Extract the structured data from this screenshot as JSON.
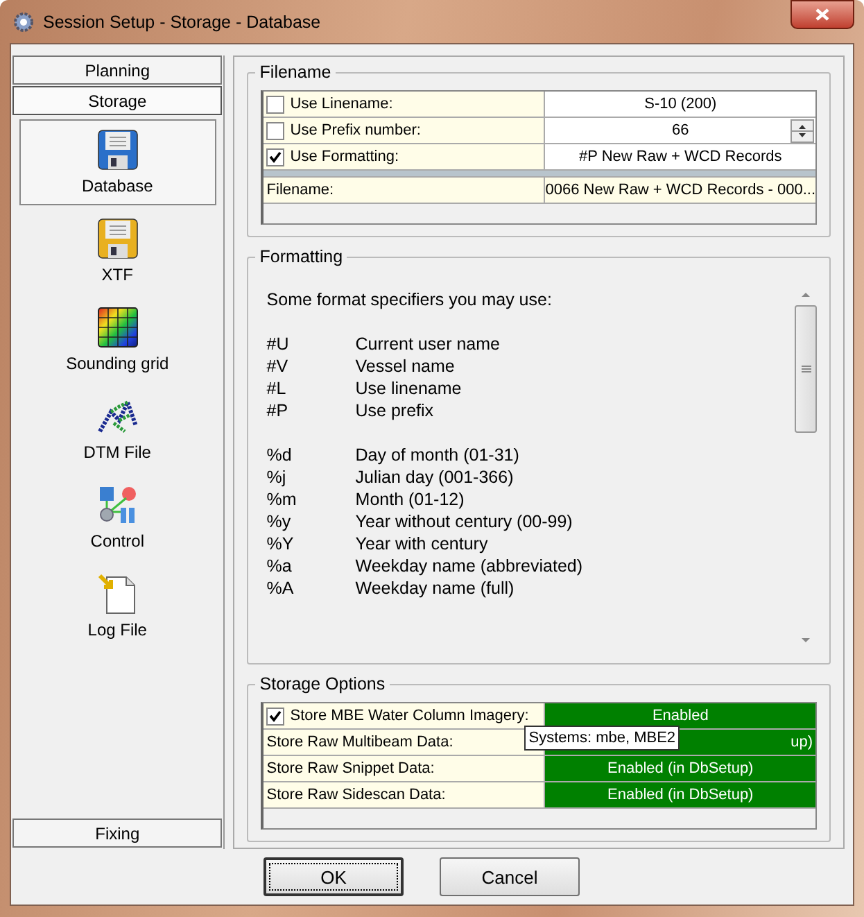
{
  "window": {
    "title": "Session Setup - Storage -  Database"
  },
  "sidebar": {
    "tabs_top": [
      {
        "label": "Planning",
        "selected": false
      },
      {
        "label": "Storage",
        "selected": true
      }
    ],
    "items": [
      {
        "label": "Database",
        "kind": "database",
        "selected": true
      },
      {
        "label": "XTF",
        "kind": "xtf",
        "selected": false
      },
      {
        "label": "Sounding grid",
        "kind": "grid",
        "selected": false
      },
      {
        "label": "DTM File",
        "kind": "dtm",
        "selected": false
      },
      {
        "label": "Control",
        "kind": "control",
        "selected": false
      },
      {
        "label": "Log File",
        "kind": "log",
        "selected": false
      }
    ],
    "tabs_bottom": [
      {
        "label": "Fixing",
        "selected": false
      }
    ]
  },
  "filename": {
    "title": "Filename",
    "rows": [
      {
        "kind": "checkbox",
        "label": "Use Linename:",
        "checked": false,
        "value": "S-10 (200)"
      },
      {
        "kind": "spinner",
        "label": "Use Prefix number:",
        "checked": false,
        "value": "66"
      },
      {
        "kind": "checkbox",
        "label": "Use Formatting:",
        "checked": true,
        "value": "#P New Raw  + WCD Records"
      },
      {
        "kind": "result",
        "label": "Filename:",
        "value": "0066 New Raw  + WCD Records - 000..."
      }
    ]
  },
  "formatting": {
    "title": "Formatting",
    "intro": "Some format specifiers you may use:",
    "groups": [
      [
        {
          "code": "#U",
          "description": "Current user name"
        },
        {
          "code": "#V",
          "description": "Vessel name"
        },
        {
          "code": "#L",
          "description": "Use linename"
        },
        {
          "code": "#P",
          "description": "Use prefix"
        }
      ],
      [
        {
          "code": "%d",
          "description": "Day of month (01-31)"
        },
        {
          "code": "%j",
          "description": "Julian day (001-366)"
        },
        {
          "code": "%m",
          "description": "Month (01-12)"
        },
        {
          "code": "%y",
          "description": "Year without century (00-99)"
        },
        {
          "code": "%Y",
          "description": "Year with century"
        },
        {
          "code": "%a",
          "description": "Weekday name (abbreviated)"
        },
        {
          "code": "%A",
          "description": "Weekday name (full)"
        }
      ]
    ]
  },
  "storage_options": {
    "title": "Storage Options",
    "rows": [
      {
        "kind": "checkbox",
        "label": "Store MBE Water Column Imagery:",
        "checked": true,
        "value": "Enabled"
      },
      {
        "kind": "plain",
        "label": "Store Raw Multibeam Data:",
        "value": "up)",
        "tooltip": "Systems: mbe, MBE2"
      },
      {
        "kind": "plain",
        "label": "Store Raw Snippet Data:",
        "value": "Enabled (in DbSetup)"
      },
      {
        "kind": "plain",
        "label": "Store Raw Sidescan Data:",
        "value": "Enabled (in DbSetup)"
      }
    ]
  },
  "buttons": [
    {
      "label": "OK",
      "default": true
    },
    {
      "label": "Cancel",
      "default": false
    }
  ]
}
